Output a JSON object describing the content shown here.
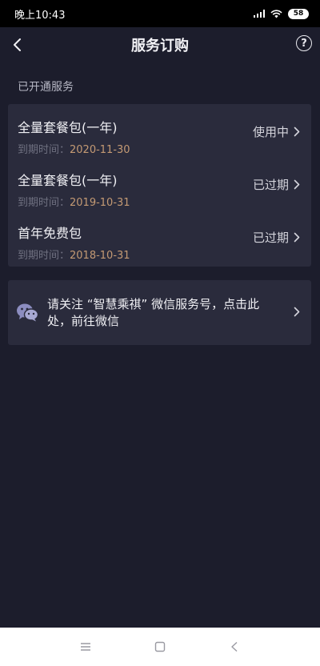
{
  "status_bar": {
    "time": "晚上10:43",
    "battery": "58"
  },
  "header": {
    "title": "服务订购",
    "help_label": "?"
  },
  "section": {
    "title": "已开通服务"
  },
  "services": [
    {
      "name": "全量套餐包(一年)",
      "expiry_label": "到期时间：",
      "expiry_date": "2020-11-30",
      "status": "使用中"
    },
    {
      "name": "全量套餐包(一年)",
      "expiry_label": "到期时间：",
      "expiry_date": "2019-10-31",
      "status": "已过期"
    },
    {
      "name": "首年免费包",
      "expiry_label": "到期时间：",
      "expiry_date": "2018-10-31",
      "status": "已过期"
    }
  ],
  "wechat": {
    "text": "请关注 “智慧乘祺” 微信服务号，点击此处，前往微信"
  },
  "colors": {
    "background": "#1c1d2c",
    "card": "#2a2b3c",
    "accent_date": "#c49a74"
  },
  "icons": [
    "back-arrow-icon",
    "help-icon",
    "chevron-right-icon",
    "wechat-icon",
    "menu-icon",
    "home-square-icon",
    "back-triangle-icon"
  ]
}
